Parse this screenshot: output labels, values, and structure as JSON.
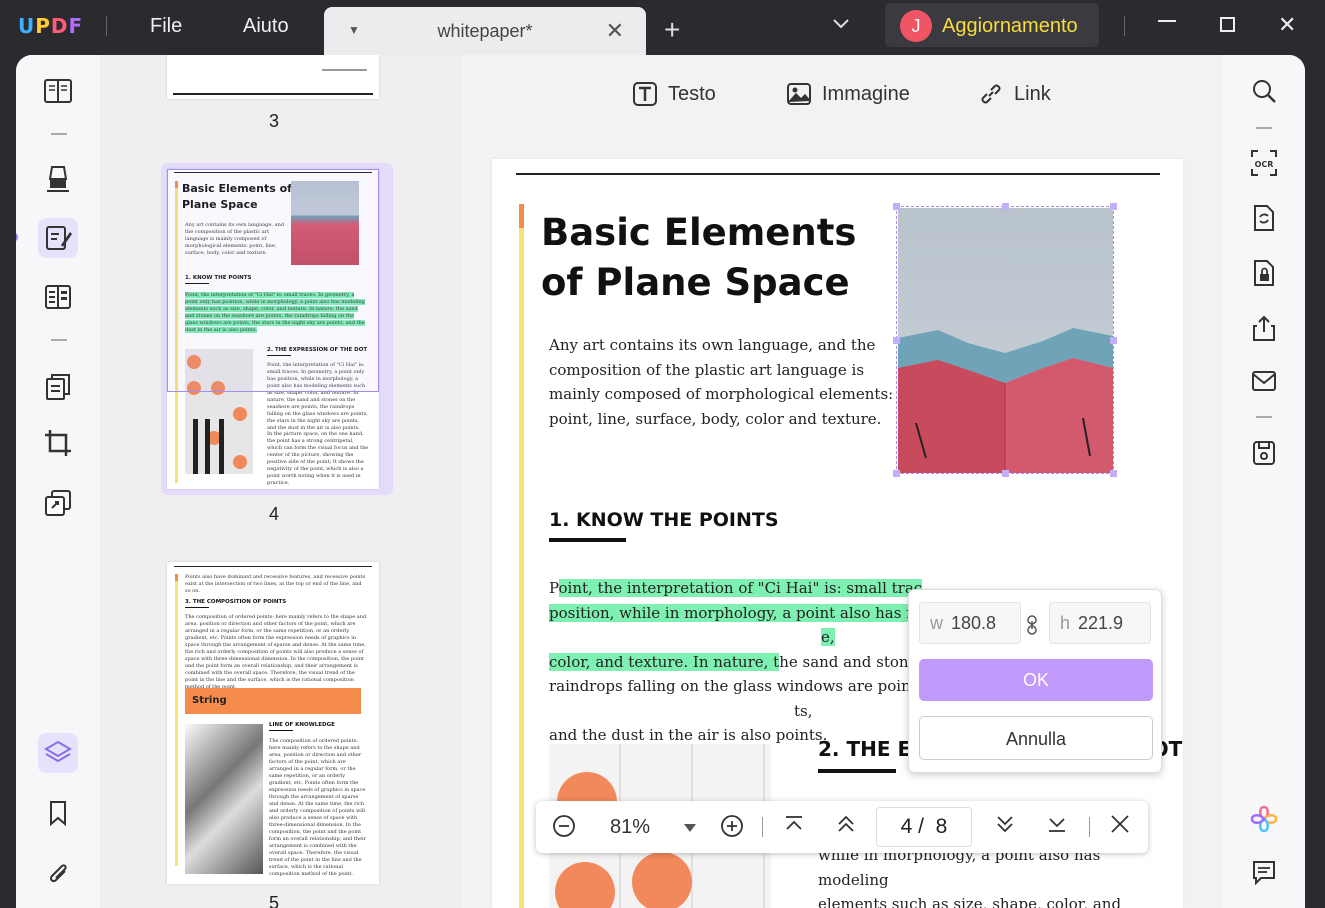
{
  "app": {
    "logo_u": "U",
    "logo_p": "P",
    "logo_d": "D",
    "logo_f": "F",
    "menu": [
      "File",
      "Aiuto"
    ],
    "tab_name": "whitepaper*",
    "upgrade_avatar": "J",
    "upgrade_label": "Aggiornamento"
  },
  "edit_toolbar": {
    "text_label": "Testo",
    "image_label": "Immagine",
    "link_label": "Link"
  },
  "thumbnails": {
    "pages": [
      "3",
      "4",
      "5"
    ],
    "page4_title": "Basic Elements of Plane Space",
    "page4_intro": "Any art contains its own language, and the composition of the plastic art language is mainly composed of morphological elements: point, line, surface, body, color and texture.",
    "page4_h1": "1. KNOW THE POINTS",
    "page4_p1": "Point, the interpretation of \"Ci Hai\" is: small traces. In geometry, a point only has position, while in morphology, a point also has modeling elements such as size, shape, color, and texture. In nature, the sand and stones on the seashore are points, the raindrops falling on the glass windows are points, the stars in the night sky are points, and the dust in the air is also points.",
    "page4_h2": "2. THE EXPRESSION OF THE DOT",
    "page4_p2": "Point, the interpretation of \"Ci Hai\" is: small traces. In geometry, a point only has position, while in morphology, a point also has modeling elements such as size, shape, color, and texture. In nature, the sand and stones on the seashore are points, the raindrops falling on the glass windows are points, the stars in the night sky are points, and the dust in the air is also points.",
    "page4_p3": "In the picture space, on the one hand, the point has a strong centripetal, which can form the visual focus and the center of the picture, showing the positive side of the point; It shows the negativity of the point, which is also a point worth noting when it is used in practice.",
    "page5_intro": "Points also have dominant and recessive features, and recessive points exist at the intersection of two lines, at the top or end of the line, and so on.",
    "page5_h1": "3. THE COMPOSITION OF POINTS",
    "page5_p1": "The composition of ordered points: here mainly refers to the shape and area, position or direction and other factors of the point, which are arranged in a regular form, or the same repetition, or an orderly gradient, etc. Points often form the expression needs of graphics in space through the arrangement of sparse and dense. At the same time, the rich and orderly composition of points will also produce a sense of space with three-dimensional dimension. In the composition, the point and the point form an overall relationship, and their arrangement is combined with the overall space. Therefore, the visual trend of the point in the line and the surface, which is the rational composition method of the point.",
    "page5_banner": "String",
    "page5_h2": "LINE OF KNOWLEDGE",
    "page5_p2": "The composition of ordered points: here mainly refers to the shape and area, position or direction and other factors of the point, which are arranged in a regular form, or the same repetition, or an orderly gradient, etc. Points often form the expression needs of graphics in space through the arrangement of sparse and dense. At the same time, the rich and orderly composition of points will also produce a sense of space with three-dimensional dimension. In the composition, the point and the point form an overall relationship, and their arrangement is combined with the overall space. Therefore, the visual trend of the point in the line and the surface, which is the rational composition method of the point."
  },
  "document": {
    "title": "Basic Elements of Plane Space",
    "intro": "Any art contains its own language, and the composition of the plastic art language is mainly composed of morphological elements: point, line, surface, body, color and texture.",
    "h_know": "1. KNOW THE POINTS",
    "p_first": "P",
    "p_hl1": "oint, the interpretation of \"Ci Hai\" is: small trac",
    "p_hl2": "position, while in morphology, a point also has m",
    "p_hl2_end": "e,",
    "p_hl3": "color, and texture. In nature, t",
    "p_rest3": "he sand and stones",
    "p_line4": "raindrops falling on the glass windows are poin",
    "p_line4_end": "ts,",
    "p_line5": "and the dust in the air is also points.",
    "h_expression": "2. THE EXPRESSION OF THE DOT",
    "expr_line2": "while in morphology, a point also has modeling",
    "expr_line3": "elements such as size, shape, color, and texture."
  },
  "resize_popup": {
    "w_label": "w",
    "w_value": "180.8",
    "h_label": "h",
    "h_value": "221.9",
    "ok": "OK",
    "cancel": "Annulla"
  },
  "nav": {
    "zoom": "81%",
    "current_page": "4",
    "separator": "/",
    "total_pages": "8"
  },
  "colors": {
    "accent": "#9b7cf6",
    "highlight": "#7ef0b1",
    "upgrade_text": "#f7dd3c"
  }
}
